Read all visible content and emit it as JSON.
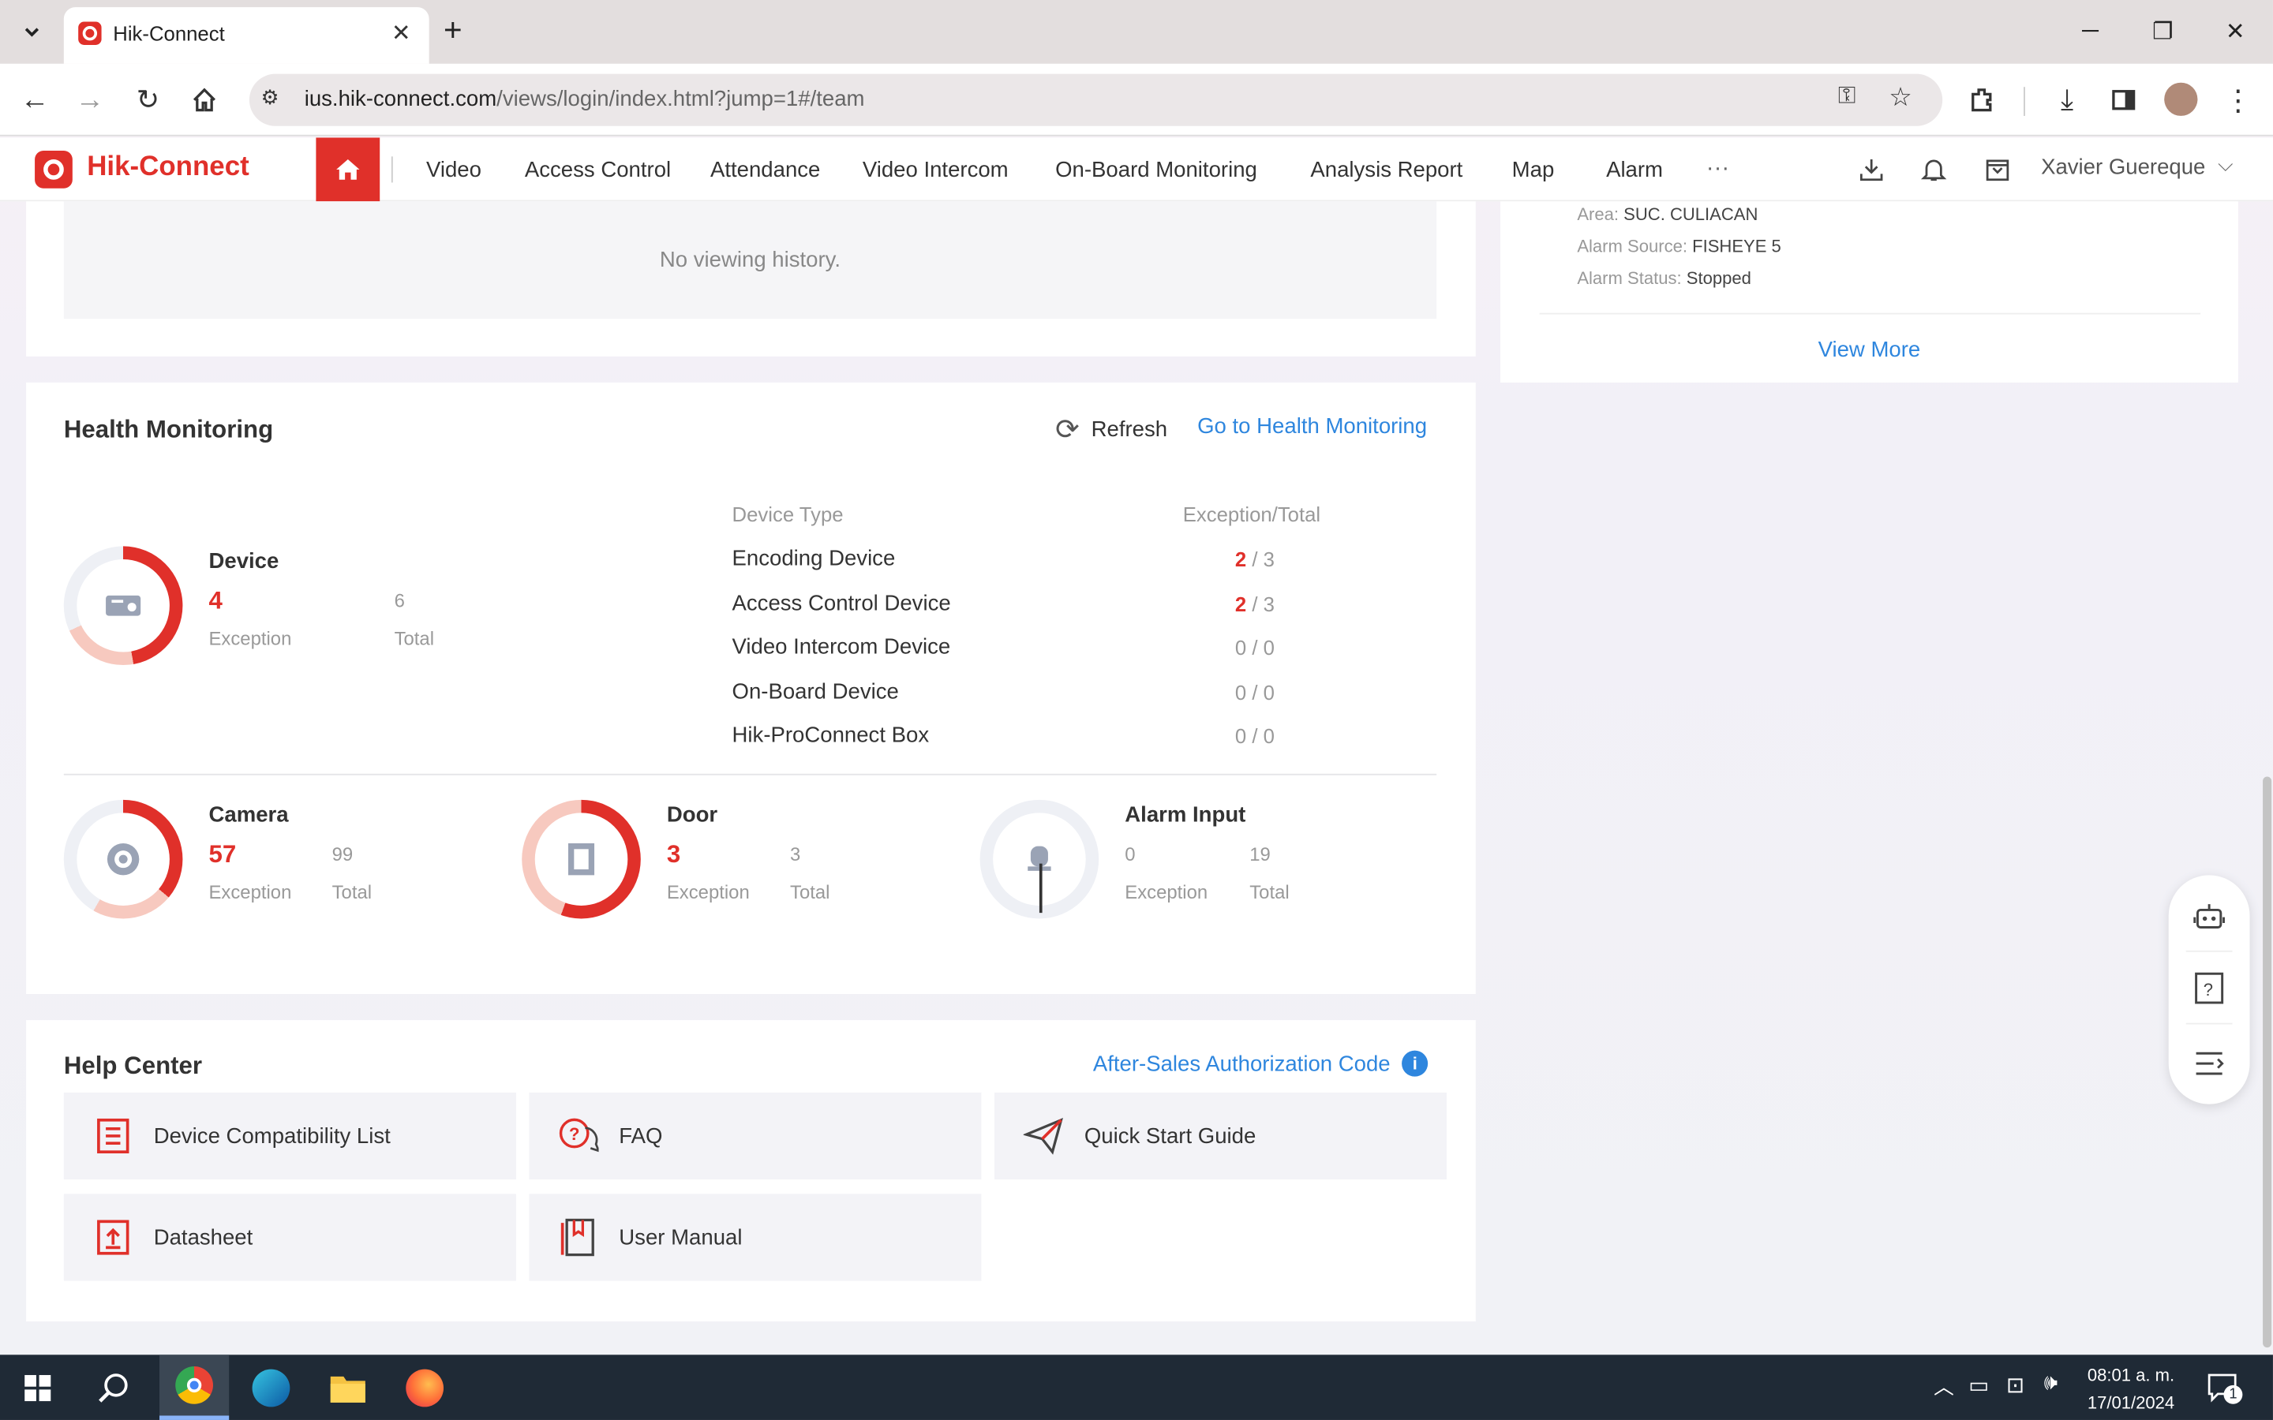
{
  "browser": {
    "tab_title": "Hik-Connect",
    "url_host": "ius.hik-connect.com",
    "url_path": "/views/login/index.html?jump=1#/team"
  },
  "app": {
    "logo_text": "Hik-Connect",
    "nav": [
      "Video",
      "Access Control",
      "Attendance",
      "Video Intercom",
      "On-Board Monitoring",
      "Analysis Report",
      "Map",
      "Alarm"
    ],
    "more": "···",
    "user": "Xavier Guereque"
  },
  "viewing": {
    "empty_text": "No viewing history."
  },
  "alarm_card": {
    "area_label": "Area:",
    "area_value": "SUC. CULIACAN",
    "source_label": "Alarm Source:",
    "source_value": "FISHEYE 5",
    "status_label": "Alarm Status:",
    "status_value": "Stopped",
    "view_more": "View More"
  },
  "health": {
    "title": "Health Monitoring",
    "refresh": "Refresh",
    "goto": "Go to Health Monitoring",
    "device": {
      "name": "Device",
      "exception": "4",
      "total": "6",
      "exception_label": "Exception",
      "total_label": "Total"
    },
    "table_headers": {
      "type": "Device Type",
      "ratio": "Exception/Total"
    },
    "rows": [
      {
        "type": "Encoding Device",
        "exc": "2",
        "sep": " / 3"
      },
      {
        "type": "Access Control Device",
        "exc": "2",
        "sep": " / 3"
      },
      {
        "type": "Video Intercom Device",
        "exc": "0",
        "sep": " / 0"
      },
      {
        "type": "On-Board Device",
        "exc": "0",
        "sep": " / 0"
      },
      {
        "type": "Hik-ProConnect Box",
        "exc": "0",
        "sep": " / 0"
      }
    ],
    "camera": {
      "name": "Camera",
      "exception": "57",
      "total": "99",
      "exception_label": "Exception",
      "total_label": "Total"
    },
    "door": {
      "name": "Door",
      "exception": "3",
      "total": "3",
      "exception_label": "Exception",
      "total_label": "Total"
    },
    "alarm_input": {
      "name": "Alarm Input",
      "exception": "0",
      "total": "19",
      "exception_label": "Exception",
      "total_label": "Total"
    }
  },
  "help": {
    "title": "Help Center",
    "auth_code": "After-Sales Authorization Code",
    "items": [
      "Device Compatibility List",
      "FAQ",
      "Quick Start Guide",
      "Datasheet",
      "User Manual"
    ]
  },
  "taskbar": {
    "time": "08:01 a. m.",
    "date": "17/01/2024",
    "notif_count": "1"
  },
  "colors": {
    "brand_red": "#e0302a",
    "link_blue": "#2e86de",
    "taskbar": "#1f2a36"
  }
}
